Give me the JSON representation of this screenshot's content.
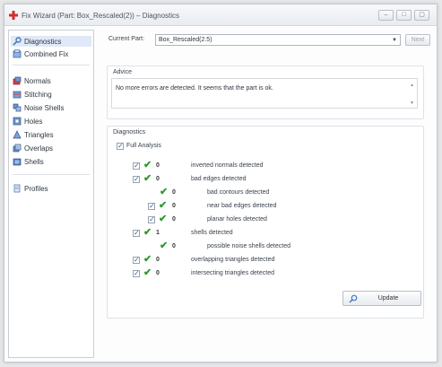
{
  "window": {
    "title": "Fix Wizard (Part: Box_Rescaled(2)) – Diagnostics",
    "controls": {
      "minimize": "–",
      "maximize": "□",
      "close": "▢"
    }
  },
  "sidebar": {
    "top_items": [
      {
        "label": "Diagnostics",
        "icon": "wrench-magnifier-icon"
      },
      {
        "label": "Combined Fix",
        "icon": "combined-fix-icon"
      }
    ],
    "tool_items": [
      {
        "label": "Normals",
        "icon": "normals-icon"
      },
      {
        "label": "Stitching",
        "icon": "stitching-icon"
      },
      {
        "label": "Noise Shells",
        "icon": "noise-shells-icon"
      },
      {
        "label": "Holes",
        "icon": "holes-icon"
      },
      {
        "label": "Triangles",
        "icon": "triangles-icon"
      },
      {
        "label": "Overlaps",
        "icon": "overlaps-icon"
      },
      {
        "label": "Shells",
        "icon": "shells-icon"
      }
    ],
    "bottom_items": [
      {
        "label": "Profiles",
        "icon": "profiles-icon"
      }
    ]
  },
  "main": {
    "current_part_label": "Current Part:",
    "current_part_value": "Box_Rescaled(2.5)",
    "next_label": "Next",
    "advice": {
      "title": "Advice",
      "text": "No more errors are detected. It seems that the part is ok."
    },
    "diagnostics": {
      "title": "Diagnostics",
      "full_analysis_label": "Full Analysis",
      "rows": [
        {
          "count": "0",
          "label": "inverted normals detected",
          "checkbox": true
        },
        {
          "count": "0",
          "label": "bad edges detected",
          "checkbox": true
        },
        {
          "count": "0",
          "label": "bad contours detected",
          "checkbox": false
        },
        {
          "count": "0",
          "label": "near bad edges detected",
          "checkbox": true
        },
        {
          "count": "0",
          "label": "planar holes detected",
          "checkbox": true
        },
        {
          "count": "1",
          "label": "shells detected",
          "checkbox": true
        },
        {
          "count": "0",
          "label": "possible noise shells detected",
          "checkbox": false
        },
        {
          "count": "0",
          "label": "overlapping triangles detected",
          "checkbox": true
        },
        {
          "count": "0",
          "label": "intersecting triangles detected",
          "checkbox": true
        }
      ],
      "update_label": "Update"
    }
  },
  "colors": {
    "accent": "#2e9a2e",
    "title_icon": "#d62b2b",
    "selection": "#dfe9f7"
  }
}
